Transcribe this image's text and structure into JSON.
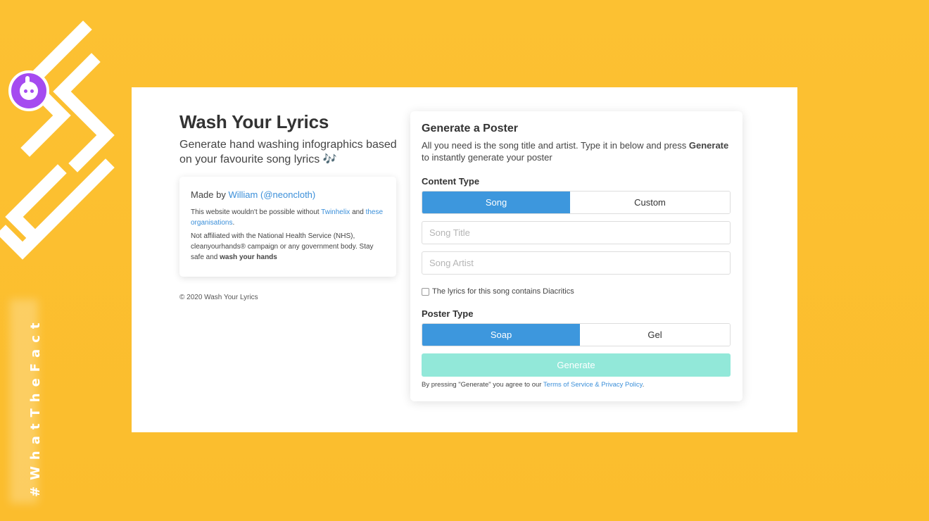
{
  "watermark": {
    "tag": "#WhatTheFact"
  },
  "page": {
    "title": "Wash Your Lyrics",
    "subtitle": "Generate hand washing infographics based on your favourite song lyrics 🎶",
    "info": {
      "made_by_prefix": "Made by ",
      "author_name": "William",
      "author_handle": "(@neoncloth)",
      "thanks_prefix": "This website wouldn't be possible without ",
      "thanks_link1": "Twinhelix",
      "thanks_and": " and ",
      "thanks_link2": "these organisations",
      "thanks_suffix": ".",
      "disclaimer": "Not affiliated with the National Health Service (NHS), cleanyourhands® campaign or any government body. Stay safe and ",
      "disclaimer_bold": "wash your hands"
    },
    "copyright": "© 2020 Wash Your Lyrics"
  },
  "form": {
    "title": "Generate a Poster",
    "desc_prefix": "All you need is the song title and artist. Type it in below and press ",
    "desc_bold": "Generate",
    "desc_suffix": " to instantly generate your poster",
    "content_type_label": "Content Type",
    "content_type_options": [
      "Song",
      "Custom"
    ],
    "content_type_selected": "Song",
    "song_title_placeholder": "Song Title",
    "song_artist_placeholder": "Song Artist",
    "diacritics_label": "The lyrics for this song contains Diacritics",
    "poster_type_label": "Poster Type",
    "poster_type_options": [
      "Soap",
      "Gel"
    ],
    "poster_type_selected": "Soap",
    "generate_label": "Generate",
    "terms_prefix": "By pressing \"Generate\" you agree to our ",
    "terms_link": "Terms of Service & Privacy Policy",
    "terms_suffix": "."
  },
  "colors": {
    "background": "#fcc132",
    "accent": "#3d97dd",
    "generate_disabled": "#92e8d9",
    "link": "#3b8fd9"
  }
}
